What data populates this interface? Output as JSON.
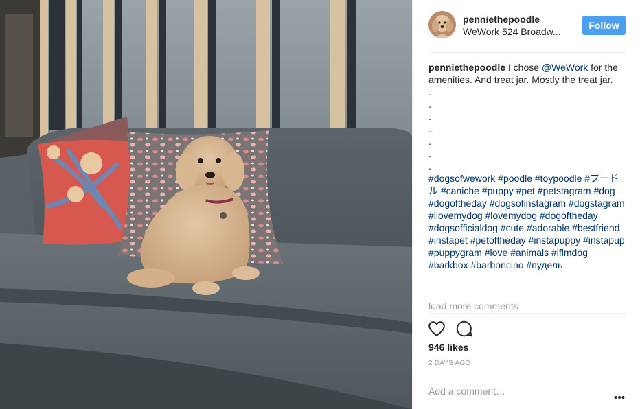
{
  "post": {
    "username": "penniethepoodle",
    "location": "WeWork 524 Broadw...",
    "follow_label": "Follow",
    "caption_text": "I chose ",
    "caption_mention": "@WeWork",
    "caption_rest": " for the amenities. And treat jar. Mostly the treat jar.",
    "dots": [
      ".",
      ".",
      ".",
      ".",
      ".",
      ".",
      "."
    ],
    "hashtags": "#dogsofwework #poodle #toypoodle #プードル #caniche #puppy #pet #petstagram #dog #dogoftheday #dogsofinstagram #dogstagram #ilovemydog #lovemydog #dogoftheday #dogsofficialdog #cute #adorable #bestfriend #instapet #petoftheday #instapuppy #instapup #puppygram #love #animals #iflmdog #barkbox #barboncino #пудель",
    "load_more": "load more comments",
    "likes": "946 likes",
    "time_ago": "2 DAYS AGO",
    "comment_placeholder": "Add a comment…"
  },
  "colors": {
    "follow_button": "#4ba1f0",
    "link": "#003569",
    "muted": "#999999"
  },
  "icons": [
    "heart-icon",
    "comment-icon",
    "more-options-icon"
  ]
}
